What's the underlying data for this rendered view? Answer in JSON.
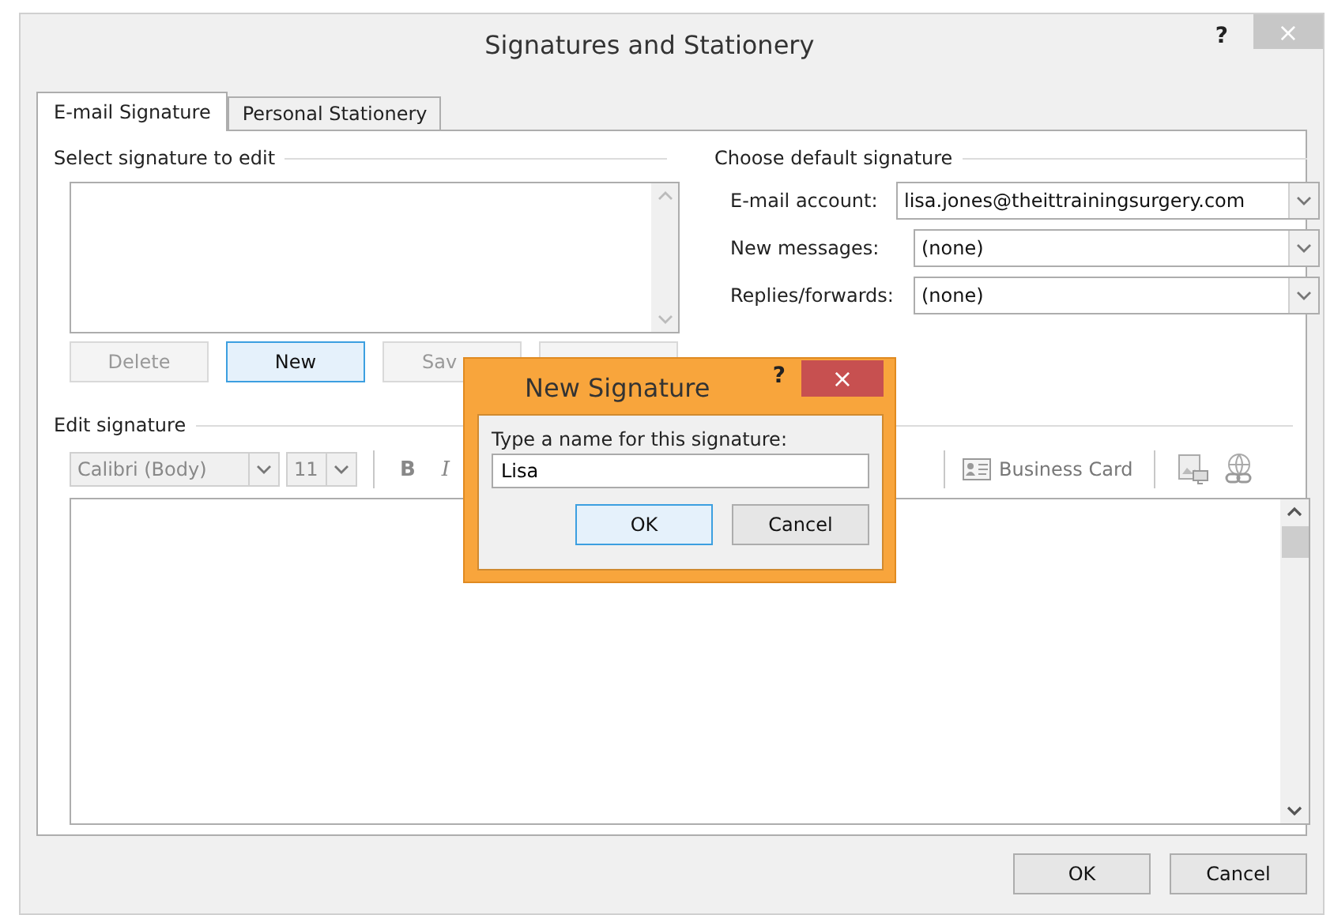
{
  "window": {
    "title": "Signatures and Stationery",
    "help": "?",
    "close": "×"
  },
  "tabs": [
    {
      "label": "E-mail Signature",
      "selected": true
    },
    {
      "label": "Personal Stationery",
      "selected": false
    }
  ],
  "select_signature": {
    "heading": "Select signature to edit",
    "buttons": [
      {
        "label": "Delete",
        "disabled": true,
        "focused": false
      },
      {
        "label": "New",
        "disabled": false,
        "focused": true
      },
      {
        "label": "Sav",
        "disabled": true,
        "focused": false
      },
      {
        "disabled": true,
        "focused": false
      }
    ]
  },
  "default_signature": {
    "heading": "Choose default signature",
    "fields": [
      {
        "label": "E-mail account:",
        "value": "lisa.jones@theittrainingsurgery.com"
      },
      {
        "label": "New messages:",
        "value": "(none)"
      },
      {
        "label": "Replies/forwards:",
        "value": "(none)"
      }
    ]
  },
  "edit_signature": {
    "heading": "Edit signature",
    "font": "Calibri (Body)",
    "size": "11",
    "bold": "B",
    "italic": "I",
    "business_card": "Business Card"
  },
  "buttons": [
    "OK",
    "Cancel"
  ],
  "dialog": {
    "title": "New Signature",
    "help": "?",
    "close": "×",
    "prompt": "Type a name for this signature:",
    "value": "Lisa",
    "buttons": [
      {
        "label": "OK",
        "focused": true
      },
      {
        "label": "Cancel",
        "focused": false
      }
    ]
  }
}
